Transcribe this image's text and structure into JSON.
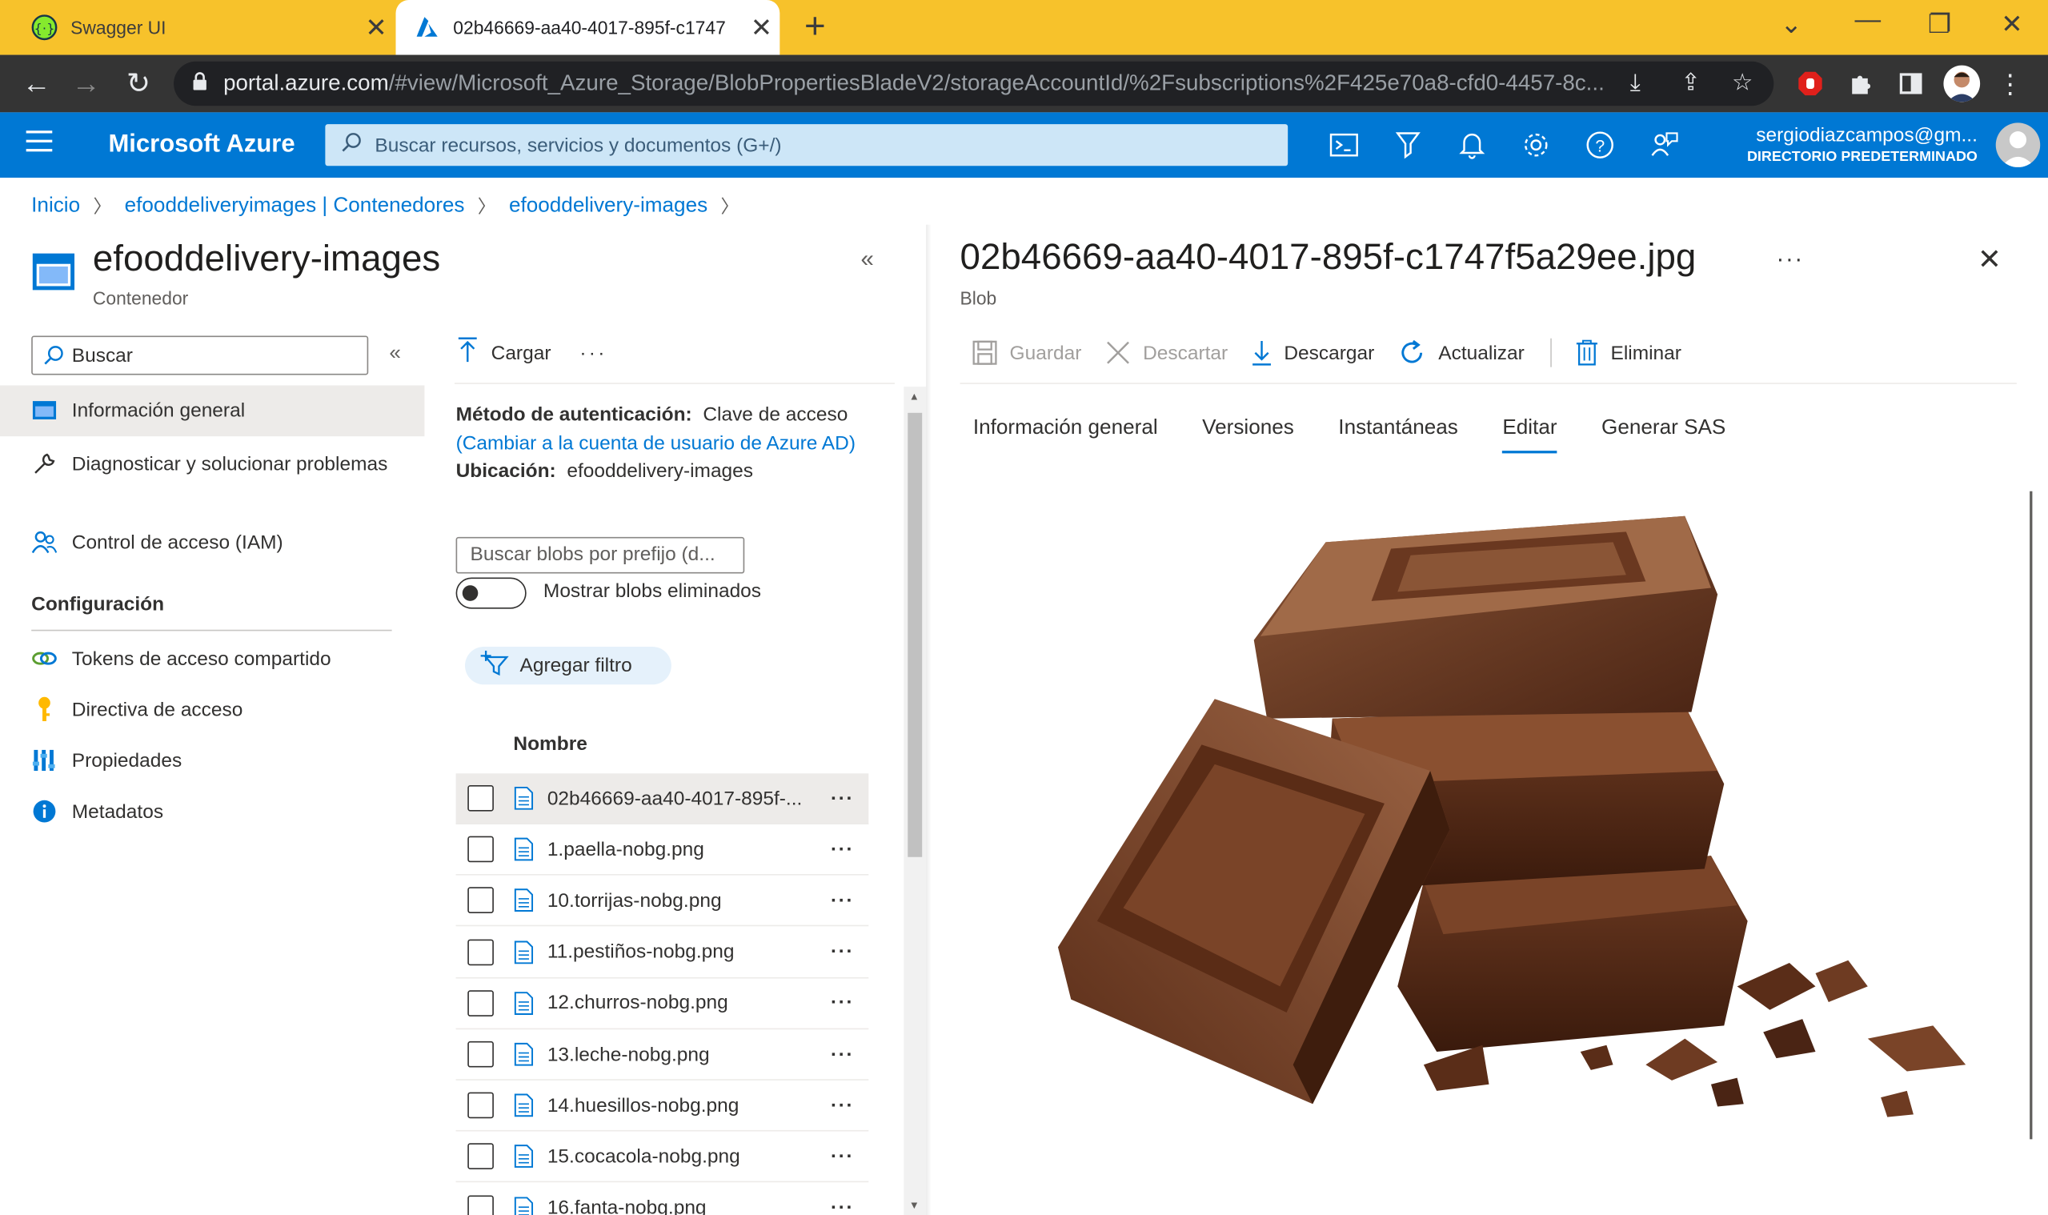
{
  "browser": {
    "tabs": [
      {
        "title": "Swagger UI",
        "active": false
      },
      {
        "title": "02b46669-aa40-4017-895f-c1747",
        "active": true
      }
    ],
    "url_host": "portal.azure.com",
    "url_path": "/#view/Microsoft_Azure_Storage/BlobPropertiesBladeV2/storageAccountId/%2Fsubscriptions%2F425e70a8-cfd0-4457-8c..."
  },
  "azure": {
    "brand": "Microsoft Azure",
    "search_placeholder": "Buscar recursos, servicios y documentos (G+/)",
    "user_email": "sergiodiazcampos@gm...",
    "user_directory": "DIRECTORIO PREDETERMINADO",
    "accent": "#0078d4"
  },
  "breadcrumb": [
    "Inicio",
    "efooddeliveryimages | Contenedores",
    "efooddelivery-images"
  ],
  "container": {
    "title": "efooddelivery-images",
    "subtitle": "Contenedor",
    "search_label": "Buscar",
    "nav": [
      {
        "label": "Información general",
        "icon": "overview-icon"
      },
      {
        "label": "Diagnosticar y solucionar problemas",
        "icon": "wrench-icon"
      },
      {
        "label": "Control de acceso (IAM)",
        "icon": "people-icon"
      }
    ],
    "settings_header": "Configuración",
    "settings": [
      {
        "label": "Tokens de acceso compartido",
        "icon": "link-icon"
      },
      {
        "label": "Directiva de acceso",
        "icon": "key-icon"
      },
      {
        "label": "Propiedades",
        "icon": "bars-icon"
      },
      {
        "label": "Metadatos",
        "icon": "info-icon"
      }
    ]
  },
  "blob_list": {
    "upload_label": "Cargar",
    "auth_label": "Método de autenticación:",
    "auth_value": "Clave de acceso",
    "auth_link": "(Cambiar a la cuenta de usuario de Azure AD)",
    "location_label": "Ubicación:",
    "location_value": "efooddelivery-images",
    "prefix_placeholder": "Buscar blobs por prefijo (d...",
    "show_deleted_label": "Mostrar blobs eliminados",
    "add_filter_label": "Agregar filtro",
    "column_name": "Nombre",
    "rows": [
      "02b46669-aa40-4017-895f-...",
      "1.paella-nobg.png",
      "10.torrijas-nobg.png",
      "11.pestiños-nobg.png",
      "12.churros-nobg.png",
      "13.leche-nobg.png",
      "14.huesillos-nobg.png",
      "15.cocacola-nobg.png",
      "16.fanta-nobg.png"
    ]
  },
  "blob": {
    "title": "02b46669-aa40-4017-895f-c1747f5a29ee.jpg",
    "subtitle": "Blob",
    "toolbar": {
      "save": "Guardar",
      "discard": "Descartar",
      "download": "Descargar",
      "refresh": "Actualizar",
      "delete": "Eliminar"
    },
    "tabs": [
      "Información general",
      "Versiones",
      "Instantáneas",
      "Editar",
      "Generar SAS"
    ],
    "active_tab": "Editar"
  }
}
